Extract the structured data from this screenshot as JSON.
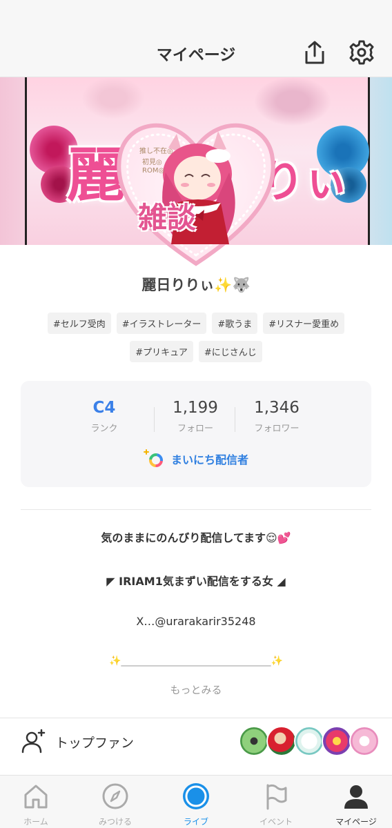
{
  "header": {
    "title": "マイページ"
  },
  "banner": {
    "left_text": "麗",
    "right_text": "りぃ"
  },
  "avatar": {
    "side_lines": [
      "推し不在◎",
      "初見◎",
      "ROM◎"
    ],
    "badge_text": "雑談"
  },
  "profile": {
    "username": "麗日りりぃ✨🐺",
    "tags": [
      "#セルフ受肉",
      "#イラストレーター",
      "#歌うま",
      "#リスナー愛重め",
      "#プリキュア",
      "#にじさんじ"
    ]
  },
  "stats": {
    "rank": {
      "value": "C4",
      "label": "ランク"
    },
    "follow": {
      "value": "1,199",
      "label": "フォロー"
    },
    "follower": {
      "value": "1,346",
      "label": "フォロワー"
    },
    "daily_badge": "まいにち配信者"
  },
  "bio": {
    "line1": "気のままにのんびり配信してます😌💕",
    "line2": "◤ IRIAM1気まずい配信をする女 ◢",
    "line3": "X…@urarakarir35248",
    "line4": "✨_______________________________✨",
    "more": "もっとみる"
  },
  "topfan": {
    "label": "トップファン"
  },
  "tabs": [
    {
      "label": "ホーム",
      "icon": "home-icon"
    },
    {
      "label": "みつける",
      "icon": "compass-icon"
    },
    {
      "label": "ライブ",
      "icon": "live-icon"
    },
    {
      "label": "イベント",
      "icon": "flag-icon"
    },
    {
      "label": "マイページ",
      "icon": "person-icon"
    }
  ],
  "colors": {
    "accent": "#1a90e8",
    "rank": "#3b80e8",
    "pink": "#ee4f94"
  }
}
